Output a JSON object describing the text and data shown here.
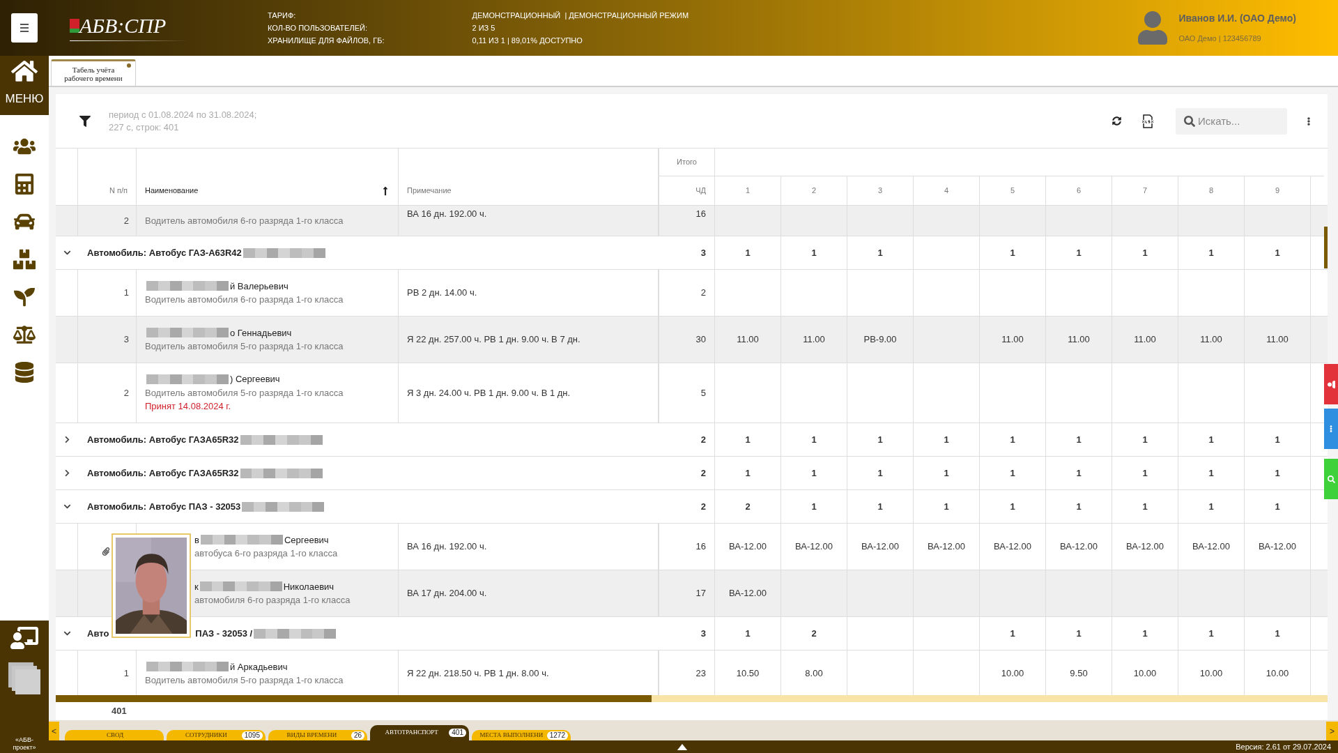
{
  "header": {
    "logo": "АБВ:СПР",
    "info": [
      {
        "label": "ТАРИФ:",
        "value": "ДЕМОНСТРАЦИОННЫЙ  | ДЕМОНСТРАЦИОННЫЙ РЕЖИМ"
      },
      {
        "label": "КОЛ-ВО ПОЛЬЗОВАТЕЛЕЙ:",
        "value": "2 ИЗ 5"
      },
      {
        "label": "ХРАНИЛИЩЕ ДЛЯ ФАЙЛОВ, ГБ:",
        "value": "0,11 ИЗ 1 | 89,01% ДОСТУПНО"
      }
    ],
    "user": {
      "name": "Иванов И.И. (ОАО Демо)",
      "org": "ОАО Демо | 123456789"
    }
  },
  "sidebar": {
    "menu_label": "МЕНЮ",
    "footer": "«АБВ-проект»"
  },
  "doc_tabs": [
    {
      "label": "Табель учёта рабочего времени",
      "modified": true
    }
  ],
  "toolbar": {
    "filter_summary": [
      "период с 01.08.2024 по 31.08.2024;",
      "227 с, строк: 401"
    ],
    "search": {
      "placeholder": "Искать..."
    }
  },
  "table": {
    "columns": {
      "total_group": "Итого",
      "num": "N п/п",
      "name": "Наименование",
      "note": "Примечание",
      "total": "ЧД",
      "days": [
        "1",
        "2",
        "3",
        "4",
        "5",
        "6",
        "7",
        "8",
        "9"
      ]
    },
    "rows": [
      {
        "kind": "person",
        "shaded": true,
        "num": "2",
        "position": "Водитель автомобиля 6-го разряда 1-го класса",
        "note": "ВА 16 дн. 192.00 ч.",
        "total": "16",
        "days": [
          {
            "kind": "empty"
          },
          {
            "kind": "empty"
          },
          {
            "kind": "empty"
          },
          {
            "kind": "empty"
          },
          {
            "kind": "empty"
          },
          {
            "kind": "empty"
          },
          {
            "kind": "empty"
          },
          {
            "kind": "empty"
          },
          {
            "kind": "empty"
          }
        ]
      },
      {
        "kind": "group",
        "expanded": true,
        "label_parts": [
          "Автомобиль: Автобус ГАЗ-А63R42"
        ],
        "total": "3",
        "days": [
          {
            "kind": "value",
            "value": "1"
          },
          {
            "kind": "value",
            "value": "1"
          },
          {
            "kind": "value",
            "value": "1"
          },
          {
            "kind": "empty"
          },
          {
            "kind": "value",
            "value": "1"
          },
          {
            "kind": "value",
            "value": "1"
          },
          {
            "kind": "value",
            "value": "1"
          },
          {
            "kind": "value",
            "value": "1"
          },
          {
            "kind": "value",
            "value": "1"
          }
        ]
      },
      {
        "kind": "person",
        "shaded": false,
        "num": "1",
        "name_parts": [
          "й Валерьевич"
        ],
        "position": "Водитель автомобиля 6-го разряда 1-го класса",
        "note": "РВ 2 дн. 14.00 ч.",
        "total": "2",
        "days": [
          {
            "kind": "empty"
          },
          {
            "kind": "empty"
          },
          {
            "kind": "empty"
          },
          {
            "kind": "empty"
          },
          {
            "kind": "empty"
          },
          {
            "kind": "empty"
          },
          {
            "kind": "empty"
          },
          {
            "kind": "empty"
          },
          {
            "kind": "empty"
          }
        ]
      },
      {
        "kind": "person",
        "shaded": true,
        "num": "3",
        "name_parts": [
          "о Геннадьевич"
        ],
        "position": "Водитель автомобиля 5-го разряда 1-го класса",
        "note": "Я 22 дн. 257.00 ч. РВ 1 дн. 9.00 ч. В 7 дн.",
        "total": "30",
        "days": [
          {
            "kind": "value",
            "value": "11.00"
          },
          {
            "kind": "value",
            "value": "11.00"
          },
          {
            "kind": "value",
            "value": "РВ-9.00"
          },
          {
            "kind": "empty"
          },
          {
            "kind": "value",
            "value": "11.00"
          },
          {
            "kind": "value",
            "value": "11.00"
          },
          {
            "kind": "value",
            "value": "11.00"
          },
          {
            "kind": "value",
            "value": "11.00"
          },
          {
            "kind": "value",
            "value": "11.00"
          }
        ]
      },
      {
        "kind": "person",
        "shaded": false,
        "num": "2",
        "name_parts": [
          ") Сергеевич"
        ],
        "position": "Водитель автомобиля 5-го разряда 1-го класса",
        "hired": "Принят 14.08.2024 г.",
        "note": "Я 3 дн. 24.00 ч. РВ 1 дн. 9.00 ч. В 1 дн.",
        "total": "5",
        "days": [
          {
            "kind": "empty"
          },
          {
            "kind": "empty"
          },
          {
            "kind": "empty"
          },
          {
            "kind": "empty"
          },
          {
            "kind": "empty"
          },
          {
            "kind": "empty"
          },
          {
            "kind": "empty"
          },
          {
            "kind": "empty"
          },
          {
            "kind": "empty"
          }
        ]
      },
      {
        "kind": "group",
        "expanded": false,
        "label_parts": [
          "Автомобиль: Автобус ГАЗА65R32"
        ],
        "total": "2",
        "days": [
          {
            "kind": "value",
            "value": "1"
          },
          {
            "kind": "value",
            "value": "1"
          },
          {
            "kind": "value",
            "value": "1"
          },
          {
            "kind": "value",
            "value": "1"
          },
          {
            "kind": "value",
            "value": "1"
          },
          {
            "kind": "value",
            "value": "1"
          },
          {
            "kind": "value",
            "value": "1"
          },
          {
            "kind": "value",
            "value": "1"
          },
          {
            "kind": "value",
            "value": "1"
          }
        ]
      },
      {
        "kind": "group",
        "expanded": false,
        "label_parts": [
          "Автомобиль: Автобус ГАЗА65R32"
        ],
        "total": "2",
        "days": [
          {
            "kind": "value",
            "value": "1"
          },
          {
            "kind": "value",
            "value": "1"
          },
          {
            "kind": "value",
            "value": "1"
          },
          {
            "kind": "value",
            "value": "1"
          },
          {
            "kind": "value",
            "value": "1"
          },
          {
            "kind": "value",
            "value": "1"
          },
          {
            "kind": "value",
            "value": "1"
          },
          {
            "kind": "value",
            "value": "1"
          },
          {
            "kind": "value",
            "value": "1"
          }
        ]
      },
      {
        "kind": "group",
        "expanded": true,
        "label_parts": [
          "Автомобиль: Автобус ПАЗ - 32053"
        ],
        "total": "2",
        "days": [
          {
            "kind": "value",
            "value": "2"
          },
          {
            "kind": "value",
            "value": "1"
          },
          {
            "kind": "value",
            "value": "1"
          },
          {
            "kind": "value",
            "value": "1"
          },
          {
            "kind": "value",
            "value": "1"
          },
          {
            "kind": "value",
            "value": "1"
          },
          {
            "kind": "value",
            "value": "1"
          },
          {
            "kind": "value",
            "value": "1"
          },
          {
            "kind": "value",
            "value": "1"
          }
        ]
      },
      {
        "kind": "person",
        "shaded": false,
        "covered": true,
        "attachment": true,
        "name_parts": [
          "в",
          "Сергеевич"
        ],
        "position": "автобуса 6-го разряда 1-го класса",
        "note": "ВА 16 дн. 192.00 ч.",
        "total": "16",
        "days": [
          {
            "kind": "value",
            "value": "ВА-12.00"
          },
          {
            "kind": "value",
            "value": "ВА-12.00"
          },
          {
            "kind": "value",
            "value": "ВА-12.00"
          },
          {
            "kind": "value",
            "value": "ВА-12.00"
          },
          {
            "kind": "value",
            "value": "ВА-12.00"
          },
          {
            "kind": "value",
            "value": "ВА-12.00"
          },
          {
            "kind": "value",
            "value": "ВА-12.00"
          },
          {
            "kind": "value",
            "value": "ВА-12.00"
          },
          {
            "kind": "value",
            "value": "ВА-12.00"
          }
        ]
      },
      {
        "kind": "person",
        "shaded": true,
        "covered": true,
        "attachment": false,
        "name_parts": [
          "к",
          "Николаевич"
        ],
        "position": "автомобиля 6-го разряда 1-го класса",
        "note": "ВА 17 дн. 204.00 ч.",
        "total": "17",
        "days": [
          {
            "kind": "value",
            "value": "ВА-12.00"
          },
          {
            "kind": "empty"
          },
          {
            "kind": "empty"
          },
          {
            "kind": "empty"
          },
          {
            "kind": "empty"
          },
          {
            "kind": "empty"
          },
          {
            "kind": "empty"
          },
          {
            "kind": "empty"
          },
          {
            "kind": "empty"
          }
        ]
      },
      {
        "kind": "group",
        "expanded": true,
        "covered": true,
        "label_parts": [
          "Авто",
          "ПАЗ - 32053 /"
        ],
        "total": "3",
        "days": [
          {
            "kind": "value",
            "value": "1"
          },
          {
            "kind": "value",
            "value": "2"
          },
          {
            "kind": "empty"
          },
          {
            "kind": "empty"
          },
          {
            "kind": "value",
            "value": "1"
          },
          {
            "kind": "value",
            "value": "1"
          },
          {
            "kind": "value",
            "value": "1"
          },
          {
            "kind": "value",
            "value": "1"
          },
          {
            "kind": "value",
            "value": "1"
          }
        ]
      },
      {
        "kind": "person",
        "shaded": false,
        "num": "1",
        "name_parts": [
          "й Аркадьевич"
        ],
        "position": "Водитель автомобиля 5-го разряда 1-го класса",
        "note": "Я 22 дн. 218.50 ч. РВ 1 дн. 8.00 ч.",
        "total": "23",
        "days": [
          {
            "kind": "value",
            "value": "10.50"
          },
          {
            "kind": "value",
            "value": "8.00"
          },
          {
            "kind": "empty"
          },
          {
            "kind": "empty"
          },
          {
            "kind": "value",
            "value": "10.00"
          },
          {
            "kind": "value",
            "value": "9.50"
          },
          {
            "kind": "value",
            "value": "10.00"
          },
          {
            "kind": "value",
            "value": "10.00"
          },
          {
            "kind": "value",
            "value": "10.00"
          }
        ]
      }
    ],
    "footer_count": "401"
  },
  "sheet_nav": {
    "prev": "<",
    "next": ">"
  },
  "sheet_tabs": [
    {
      "label": "СВОД",
      "selected": false
    },
    {
      "label": "СОТРУДНИКИ",
      "count": "1095",
      "selected": false
    },
    {
      "label": "ВИДЫ ВРЕМЕНИ",
      "count": "26",
      "selected": false
    },
    {
      "label": "АВТОТРАНСПОРТ",
      "count": "401",
      "selected": true
    },
    {
      "label": "МЕСТА ВЫПОЛНЕНИ",
      "count": "1272",
      "selected": false
    }
  ],
  "status_bar": {
    "version": "Версия: 2.61 от 29.07.2024"
  }
}
